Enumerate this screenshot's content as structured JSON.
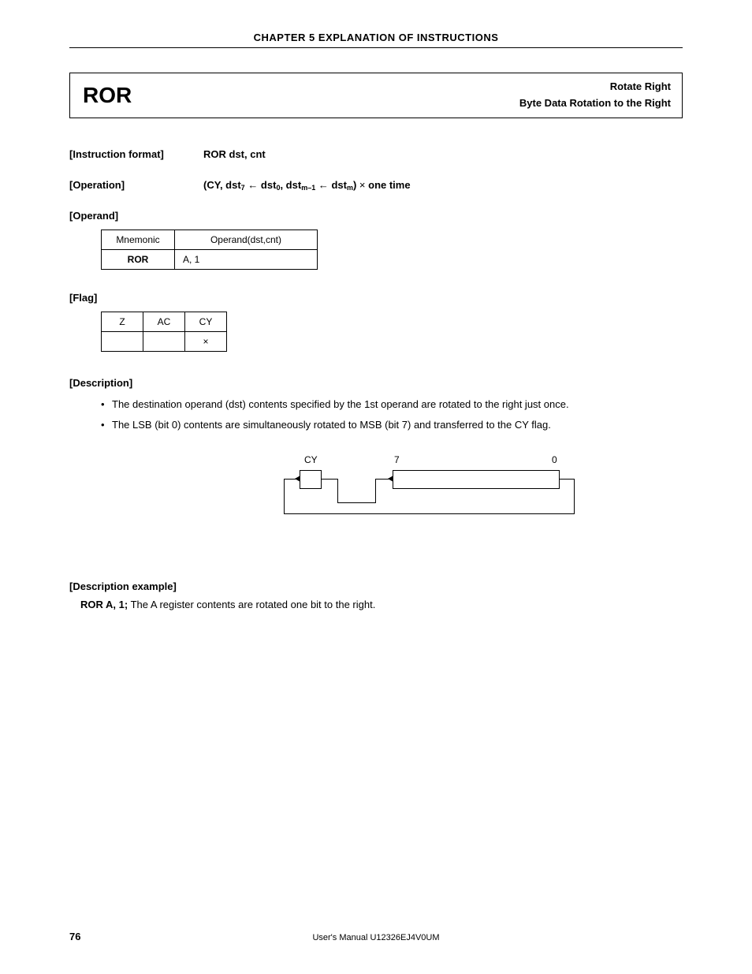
{
  "header": {
    "chapter_title": "CHAPTER 5  EXPLANATION OF INSTRUCTIONS"
  },
  "title_box": {
    "mnemonic": "ROR",
    "right_line1": "Rotate Right",
    "right_line2": "Byte Data Rotation to the Right"
  },
  "instr_format": {
    "label": "[Instruction format]",
    "value": "ROR dst, cnt"
  },
  "operation": {
    "label": "[Operation]",
    "prefix": "(CY, dst",
    "sub1": "7",
    "mid1": " dst",
    "sub2": "0",
    "mid2": ", dst",
    "sub3": "m–1",
    "mid3": " dst",
    "sub4": "m",
    "suffix1": ") ",
    "suffix2": " one time"
  },
  "operand": {
    "label": "[Operand]",
    "th_mnemonic": "Mnemonic",
    "th_operand": "Operand(dst,cnt)",
    "row_mn": "ROR",
    "row_op": "A, 1"
  },
  "flag": {
    "label": "[Flag]",
    "h_z": "Z",
    "h_ac": "AC",
    "h_cy": "CY",
    "v_z": "",
    "v_ac": "",
    "v_cy": "×"
  },
  "description": {
    "label": "[Description]",
    "bullets": [
      "The destination operand (dst) contents specified by the 1st operand are rotated to the right just once.",
      "The LSB (bit 0) contents are simultaneously rotated to MSB (bit 7) and transferred to the CY flag."
    ]
  },
  "diagram": {
    "cy": "CY",
    "bit7": "7",
    "bit0": "0"
  },
  "example": {
    "label": "[Description example]",
    "code": "ROR A, 1;",
    "text": "  The A register contents are rotated one bit to the right."
  },
  "footer": {
    "page": "76",
    "center": "User's Manual  U12326EJ4V0UM"
  }
}
